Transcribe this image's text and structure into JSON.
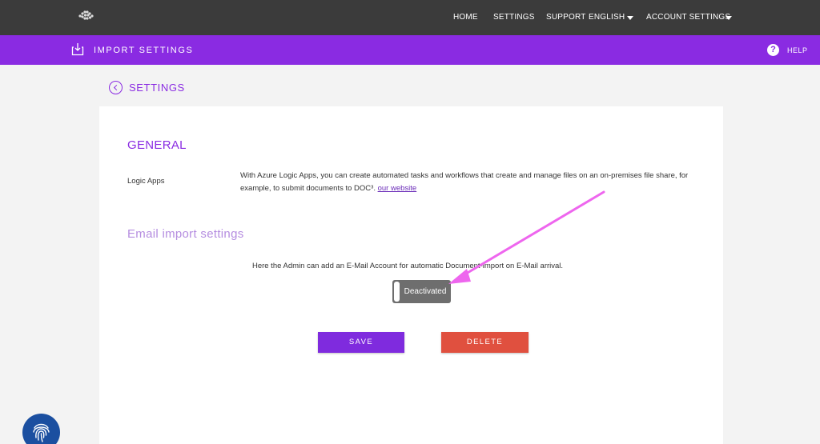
{
  "topnav": {
    "items": [
      "HOME",
      "SETTINGS",
      "SUPPORT"
    ],
    "language": "ENGLISH",
    "account": "ACCOUNT SETTINGS"
  },
  "subheader": {
    "title": "IMPORT SETTINGS",
    "help": "HELP",
    "icon": "import-icon"
  },
  "breadcrumb": {
    "back_label": "SETTINGS"
  },
  "general": {
    "title": "GENERAL",
    "logic_apps_label": "Logic Apps",
    "logic_apps_text": "With Azure Logic Apps, you can create automated tasks and workflows that create and manage files on an on-premises file share, for example, to submit documents to DOC³.",
    "link_text": "our website"
  },
  "email": {
    "title": "Email import settings",
    "description": "Here the Admin can add an E-Mail Account for automatic Document-import on E-Mail arrival.",
    "toggle_label": "Deactivated"
  },
  "actions": {
    "save": "SAVE",
    "delete": "DELETE"
  },
  "colors": {
    "accent": "#8a2be2",
    "danger": "#e0503f",
    "topbar": "#3b3b3b",
    "annotation": "#ee66ee"
  }
}
